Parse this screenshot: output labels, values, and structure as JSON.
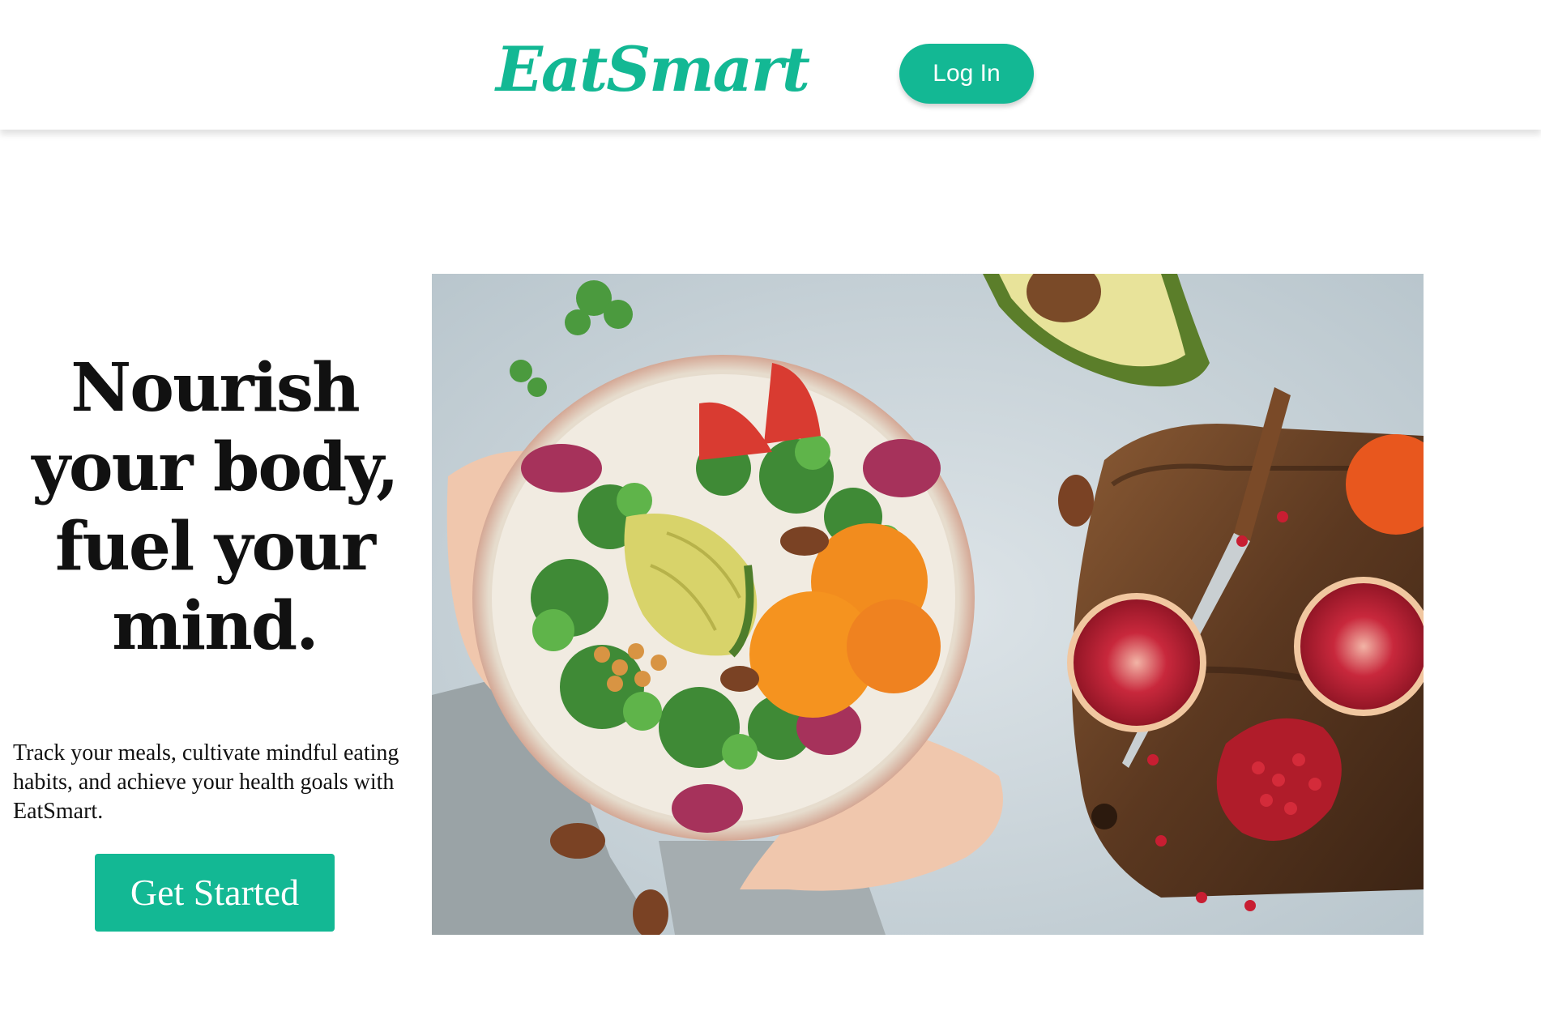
{
  "header": {
    "logo": "EatSmart",
    "login_label": "Log In"
  },
  "hero": {
    "title": "Nourish your body, fuel your mind.",
    "subtitle": "Track your meals, cultivate mindful eating habits, and achieve your health goals with EatSmart.",
    "cta_label": "Get Started"
  },
  "colors": {
    "brand": "#13b894",
    "text": "#111111",
    "background": "#ffffff"
  }
}
